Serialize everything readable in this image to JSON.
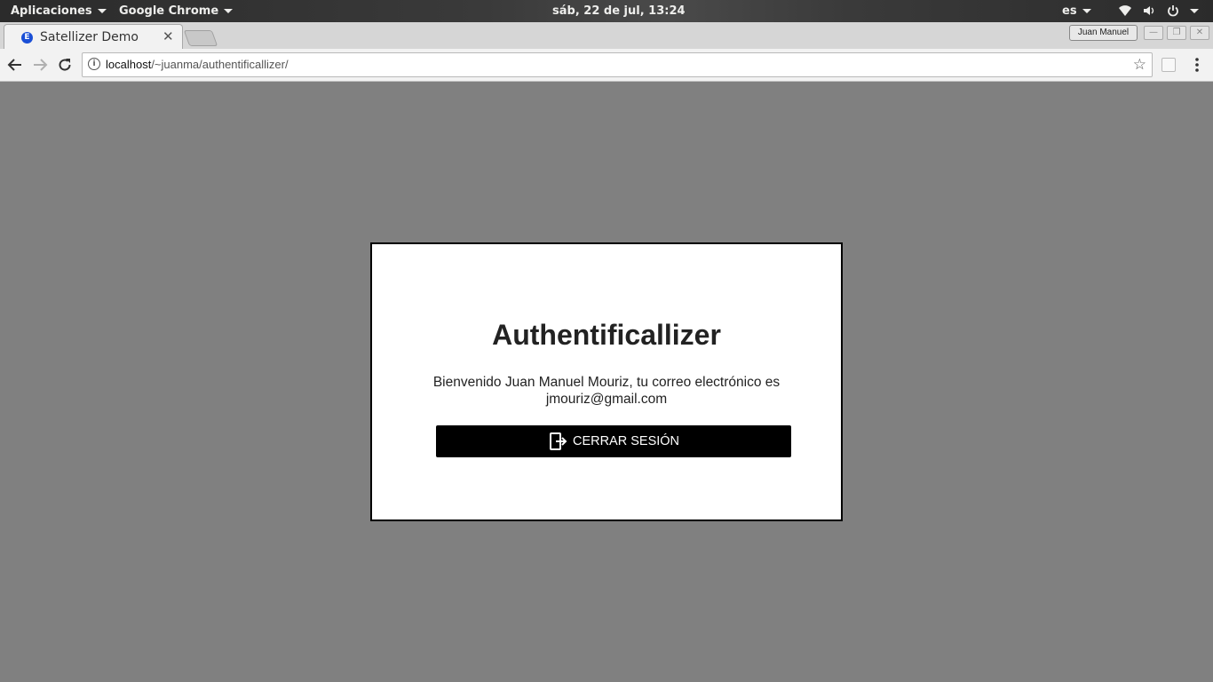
{
  "system_bar": {
    "apps_menu": "Aplicaciones",
    "app_menu": "Google Chrome",
    "clock": "sáb, 22 de jul, 13:24",
    "language": "es",
    "icons": [
      "wifi-icon",
      "volume-icon",
      "power-icon"
    ]
  },
  "browser": {
    "tab": {
      "title": "Satellizer Demo",
      "favicon_letter": "E"
    },
    "profile_name": "Juan Manuel",
    "url": {
      "host": "localhost",
      "path": "/~juanma/authentificallizer/"
    }
  },
  "page": {
    "heading": "Authentificallizer",
    "welcome_line1": "Bienvenido Juan Manuel Mouriz, tu correo electrónico es",
    "welcome_line2": "jmouriz@gmail.com",
    "logout_label": "CERRAR SESIÓN"
  },
  "colors": {
    "page_background": "#808080",
    "card_background": "#ffffff",
    "button_background": "#000000",
    "favicon": "#1a4fd6"
  }
}
